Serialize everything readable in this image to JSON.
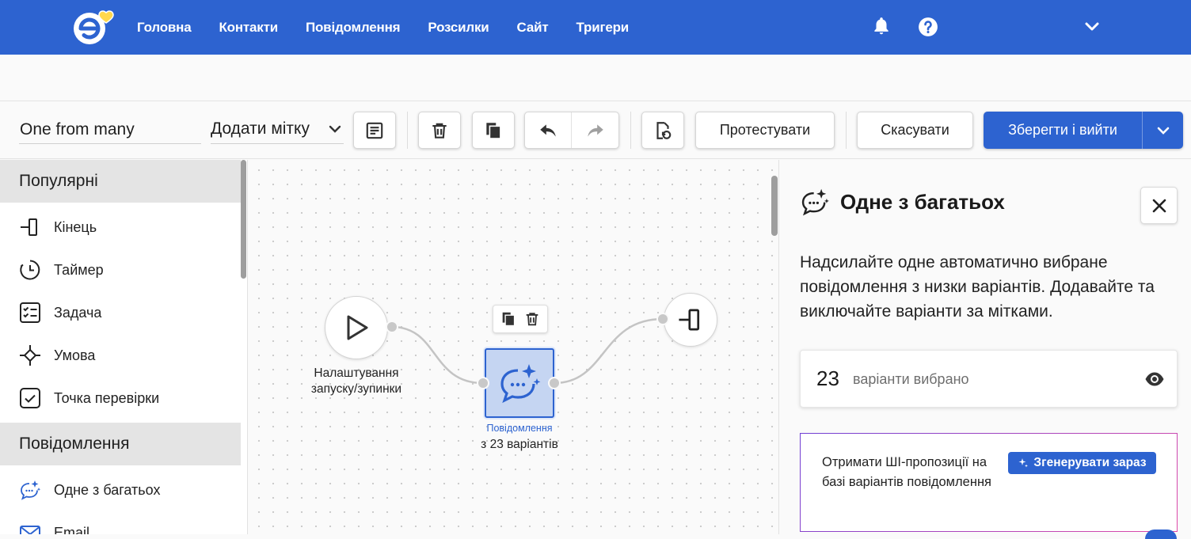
{
  "nav": {
    "items": [
      "Головна",
      "Контакти",
      "Повідомлення",
      "Розсилки",
      "Сайт",
      "Тригери"
    ]
  },
  "toolbar": {
    "flow_name": "One from many",
    "add_tag_label": "Додати мітку",
    "test_label": "Протестувати",
    "cancel_label": "Скасувати",
    "save_label": "Зберегти і вийти"
  },
  "sidebar": {
    "groups": [
      {
        "title": "Популярні",
        "items": [
          {
            "label": "Кінець",
            "icon": "end-icon"
          },
          {
            "label": "Таймер",
            "icon": "timer-icon"
          },
          {
            "label": "Задача",
            "icon": "task-icon"
          },
          {
            "label": "Умова",
            "icon": "condition-icon"
          },
          {
            "label": "Точка перевірки",
            "icon": "checkpoint-icon"
          }
        ]
      },
      {
        "title": "Повідомлення",
        "items": [
          {
            "label": "Одне з багатьох",
            "icon": "one-from-many-icon"
          },
          {
            "label": "Email",
            "icon": "email-icon"
          }
        ]
      }
    ]
  },
  "canvas": {
    "start_node": {
      "label_line1": "Налаштування",
      "label_line2": "запуску/зупинки"
    },
    "message_node": {
      "type_label": "Повідомлення",
      "subtitle": "з 23 варіантів"
    }
  },
  "panel": {
    "title": "Одне з багатьох",
    "description": "Надсилайте одне автоматично вибране повідомлення з низки варіантів. Додавайте та виключайте варіанти за мітками.",
    "variants_count": "23",
    "variants_label": "варіанти вибрано",
    "ai_text": "Отримати ШІ-пропозиції на базі варіантів повідомлення",
    "ai_button": "Згенерувати зараз"
  },
  "colors": {
    "brand": "#2d63d0",
    "node_fill": "#c5d5f2",
    "ai_border_start": "#6f3fd4",
    "ai_border_end": "#e04aa8"
  }
}
